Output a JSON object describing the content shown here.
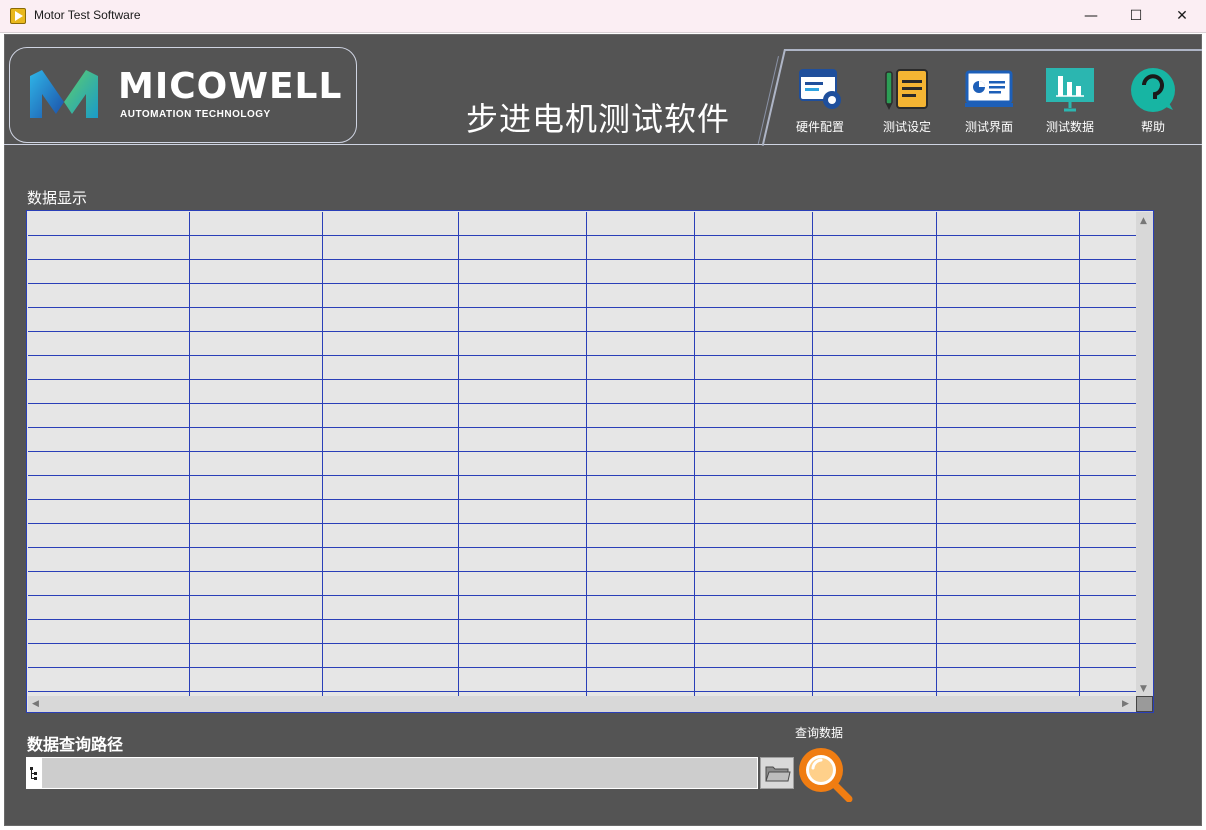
{
  "window": {
    "title": "Motor Test Software",
    "min_glyph": "—",
    "max_glyph": "☐",
    "close_glyph": "✕"
  },
  "logo": {
    "word": "MICOWELL",
    "subtitle": "AUTOMATION TECHNOLOGY"
  },
  "app_title": "步进电机测试软件",
  "nav": [
    {
      "label": "硬件配置",
      "icon": "hardware-config-icon"
    },
    {
      "label": "测试设定",
      "icon": "test-settings-icon"
    },
    {
      "label": "测试界面",
      "icon": "test-interface-icon"
    },
    {
      "label": "测试数据",
      "icon": "test-data-icon"
    },
    {
      "label": "帮助",
      "icon": "help-icon"
    }
  ],
  "data_display": {
    "label": "数据显示",
    "row_count": 20,
    "column_count": 9
  },
  "path": {
    "label": "数据查询路径",
    "value": "",
    "browse_icon": "folder-icon"
  },
  "query": {
    "label": "查询数据",
    "icon": "search-icon"
  },
  "colors": {
    "background": "#545454",
    "grid_line": "#2a3fb8",
    "cell": "#e6e6e6",
    "query_orange": "#f07d12"
  }
}
